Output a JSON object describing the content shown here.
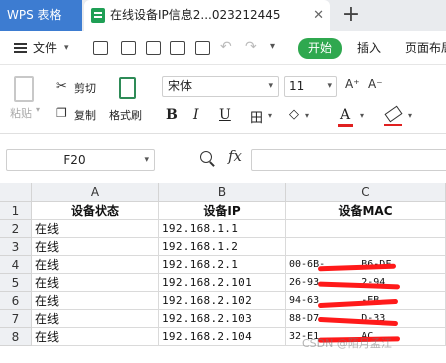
{
  "tabs": {
    "app_label": "WPS 表格",
    "doc_title": "在线设备IP信息2...023212445",
    "close_glyph": "✕",
    "add_glyph": "+"
  },
  "menu": {
    "file_label": "文件",
    "start_label": "开始",
    "insert_label": "插入",
    "layout_label": "页面布局"
  },
  "ribbon": {
    "paste_label": "粘贴",
    "cut_label": "剪切",
    "copy_label": "复制",
    "format_painter_label": "格式刷",
    "font_name": "宋体",
    "font_size": "11",
    "bold": "B",
    "italic": "I",
    "underline": "U",
    "border": "田",
    "fill": "◇",
    "font_color": "A",
    "clear": ""
  },
  "formula_bar": {
    "cell_ref": "F20",
    "fx_label": "fx",
    "formula": ""
  },
  "sheet": {
    "columns": [
      "A",
      "B",
      "C"
    ],
    "row_numbers": [
      "1",
      "2",
      "3",
      "4",
      "5",
      "6",
      "7",
      "8"
    ],
    "header": [
      "设备状态",
      "设备IP",
      "设备MAC"
    ],
    "rows": [
      {
        "status": "在线",
        "ip": "192.168.1.1",
        "mac": ""
      },
      {
        "status": "在线",
        "ip": "192.168.1.2",
        "mac": ""
      },
      {
        "status": "在线",
        "ip": "192.168.2.1",
        "mac": "00-6B-      B6-DF"
      },
      {
        "status": "在线",
        "ip": "192.168.2.101",
        "mac": "26-93       2-94"
      },
      {
        "status": "在线",
        "ip": "192.168.2.102",
        "mac": "94-63       -EB"
      },
      {
        "status": "在线",
        "ip": "192.168.2.103",
        "mac": "88-D7       D-33"
      },
      {
        "status": "在线",
        "ip": "192.168.2.104",
        "mac": "32-E1       AC"
      }
    ]
  },
  "watermark": "CSDN @陌月孟江",
  "colors": {
    "app_tab": "#3d7cd1",
    "start_button": "#2fa84f",
    "redaction": "#ff1a1a"
  }
}
